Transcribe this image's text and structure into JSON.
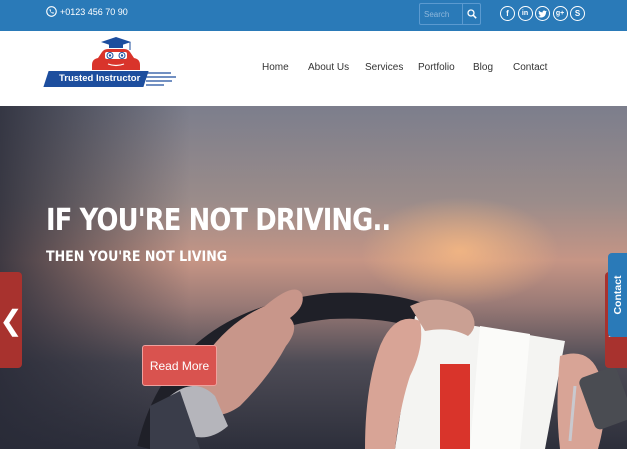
{
  "topbar": {
    "phone": "+0123 456 70 90",
    "phone_icon": "phone-icon",
    "search_placeholder": "Search",
    "search_icon": "search-icon",
    "socials": [
      {
        "name": "facebook-icon",
        "glyph": "f"
      },
      {
        "name": "linkedin-icon",
        "glyph": "in"
      },
      {
        "name": "twitter-icon",
        "glyph": "t"
      },
      {
        "name": "google-plus-icon",
        "glyph": "g+"
      },
      {
        "name": "skype-icon",
        "glyph": "S"
      }
    ]
  },
  "logo": {
    "text": "Trusted Instructor"
  },
  "nav": {
    "items": [
      "Home",
      "About Us",
      "Services",
      "Portfolio",
      "Blog",
      "Contact"
    ]
  },
  "hero": {
    "title": "IF YOU'RE NOT DRIVING..",
    "subtitle": "THEN YOU'RE NOT LIVING",
    "button": "Read More",
    "prev": "❮",
    "next": "❯"
  },
  "contact_tab": "Contact",
  "colors": {
    "primary": "#2a7ab8",
    "accent": "#d9534f",
    "arrow": "#a8322e",
    "logo_blue": "#1d4e9e",
    "logo_red": "#d9342b"
  }
}
